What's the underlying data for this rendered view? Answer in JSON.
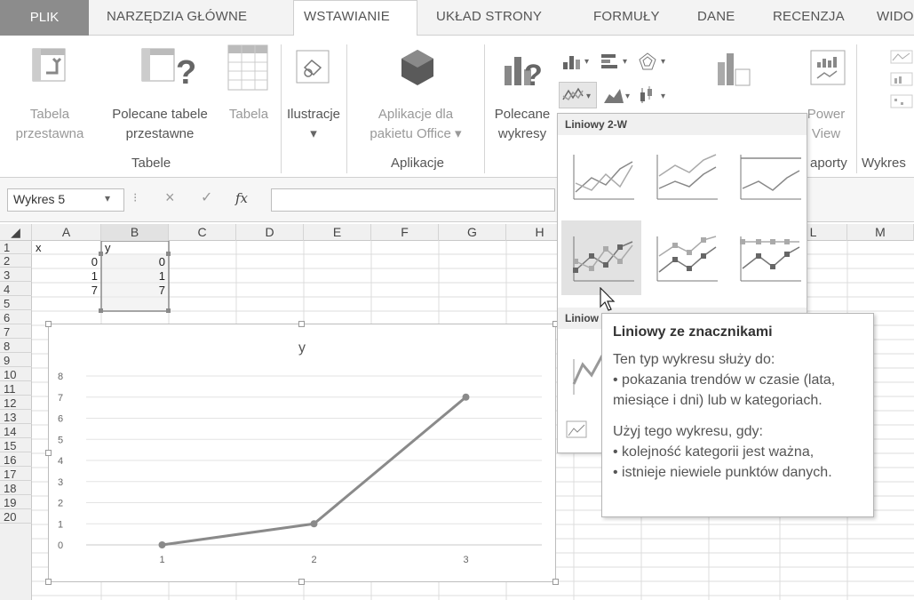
{
  "tabs": {
    "file": "PLIK",
    "home": "NARZĘDZIA GŁÓWNE",
    "insert": "WSTAWIANIE",
    "layout": "UKŁAD STRONY",
    "formulas": "FORMUŁY",
    "data": "DANE",
    "review": "RECENZJA",
    "view": "WIDO"
  },
  "ribbon": {
    "pivot_line1": "Tabela",
    "pivot_line2": "przestawna",
    "recpivot_line1": "Polecane tabele",
    "recpivot_line2": "przestawne",
    "table": "Tabela",
    "illustrations": "Ilustracje",
    "apps_line1": "Aplikacje dla",
    "apps_line2": "pakietu Office",
    "recchart_line1": "Polecane",
    "recchart_line2": "wykresy",
    "wykres_partial": "Wykres",
    "power_line1": "Power",
    "power_line2": "View",
    "groups": {
      "tables": "Tabele",
      "apps": "Aplikacje",
      "reports": "aporty",
      "sparklines": "Wykres"
    }
  },
  "formula_bar": {
    "name_box": "Wykres 5",
    "fx": "fx",
    "value": ""
  },
  "grid": {
    "columns": [
      "A",
      "B",
      "C",
      "D",
      "E",
      "F",
      "G",
      "H",
      "L",
      "M"
    ],
    "rows": [
      "1",
      "2",
      "3",
      "4",
      "5",
      "6",
      "7",
      "8",
      "9",
      "10",
      "11",
      "12",
      "13",
      "14",
      "15",
      "16",
      "17",
      "18",
      "19",
      "20"
    ],
    "cells": {
      "A1": "x",
      "B1": "y",
      "A2": "0",
      "B2": "0",
      "A3": "1",
      "B3": "1",
      "A4": "7",
      "B4": "7"
    }
  },
  "chart_data": {
    "type": "line",
    "title": "y",
    "categories": [
      "1",
      "2",
      "3"
    ],
    "series": [
      {
        "values": [
          0,
          1,
          7
        ]
      }
    ],
    "ylim": [
      0,
      8
    ],
    "yticks": [
      "0",
      "1",
      "2",
      "3",
      "4",
      "5",
      "6",
      "7",
      "8"
    ],
    "grid": true,
    "markers": true,
    "color": "#8a8a8a"
  },
  "dropdown": {
    "header1": "Liniowy 2-W",
    "header2_partial": "Liniow"
  },
  "tooltip": {
    "title": "Liniowy ze znacznikami",
    "line1": "Ten typ wykresu służy do:",
    "line2": "• pokazania trendów w czasie (lata,",
    "line3": "miesiące i dni) lub w kategoriach.",
    "line4": "Użyj tego wykresu, gdy:",
    "line5": "• kolejność kategorii jest ważna,",
    "line6": "• istnieje niewiele punktów danych."
  }
}
